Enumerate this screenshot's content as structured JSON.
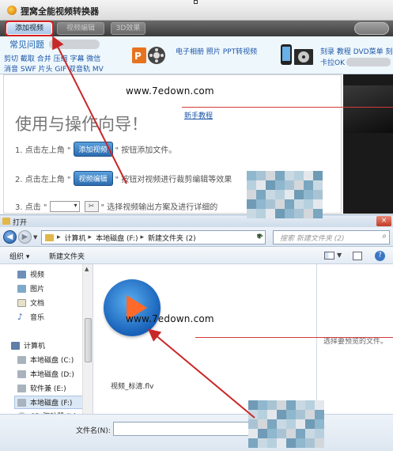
{
  "app": {
    "title": "狸窝全能视频转换器",
    "toolbar": {
      "add_video": "添加视频",
      "video_edit": "视频编辑",
      "effects": "3D效果"
    },
    "faq": "常见问题",
    "ad_line1": "剪切 截取 合并 压缩 字幕 微信",
    "ad_line2": "消音 SWF 片头 GIF 双音轨 MV",
    "ad_middle": "电子相册 照片 PPT转视频",
    "ad_right1": "刻录 教程 DVD菜单 刻",
    "ad_right2": "卡拉OK",
    "guide": {
      "link": "新手教程",
      "heading": "使用与操作向导！",
      "step1_prefix": "1. 点击左上角 \"",
      "step1_button": "添加视频",
      "step1_suffix": "\" 按钮添加文件。",
      "step2_prefix": "2. 点击左上角 \"",
      "step2_button": "视频编辑",
      "step2_suffix": "\" 按钮对视频进行裁剪编辑等效果",
      "step3_prefix": "3. 点击 \"",
      "step3_suffix": "\" 选择视频输出方案及进行详细的"
    }
  },
  "dialog": {
    "title": "打开",
    "close": "×",
    "path": [
      "计算机",
      "本地磁盘 (F:)",
      "新建文件夹 (2)"
    ],
    "search_placeholder": "搜索 新建文件夹 (2)",
    "organize": "组织 ▾",
    "new_folder": "新建文件夹",
    "help": "?",
    "nav_items": [
      {
        "label": "视频",
        "icon": "video-library-icon"
      },
      {
        "label": "图片",
        "icon": "pictures-library-icon"
      },
      {
        "label": "文档",
        "icon": "documents-library-icon"
      },
      {
        "label": "音乐",
        "icon": "music-library-icon"
      }
    ],
    "computer": "计算机",
    "drives": [
      {
        "label": "本地磁盘 (C:)"
      },
      {
        "label": "本地磁盘 (D:)"
      },
      {
        "label": "软件兼 (E:)"
      },
      {
        "label": "本地磁盘 (F:)"
      },
      {
        "label": "CD 驱动器 (I:)"
      }
    ],
    "file_name": "视频_标清.flv",
    "preview_msg": "选择要预览的文件。",
    "filename_label": "文件名(N):"
  },
  "watermark": "www.7edown.com",
  "colors": {
    "arrow": "#c82828",
    "red_line": "#d23a3a",
    "accent_blue": "#2c6cb0",
    "mosaic": [
      "#8fb7ce",
      "#b7d0de",
      "#d3d7db",
      "#6f9bb6",
      "#c9d9e3",
      "#a8c4d4",
      "#e4e8ec",
      "#7aa6c0"
    ]
  }
}
